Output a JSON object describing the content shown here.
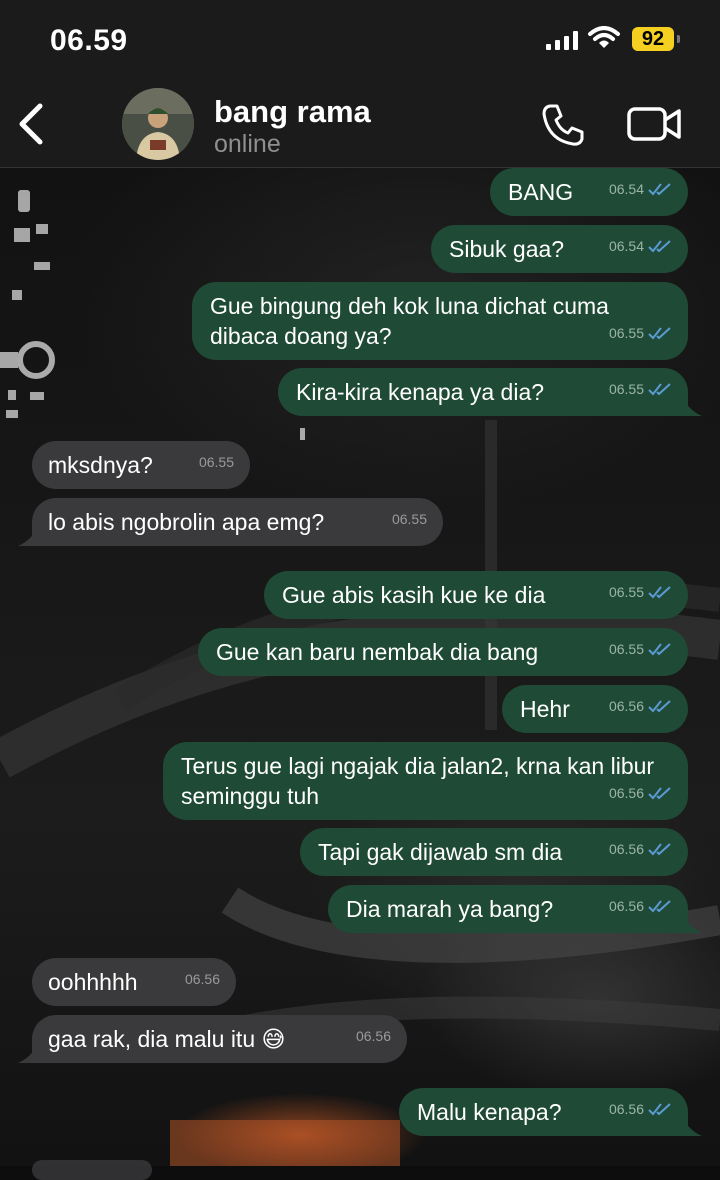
{
  "status_bar": {
    "time": "06.59",
    "battery": "92"
  },
  "header": {
    "name": "bang rama",
    "status": "online"
  },
  "messages": [
    {
      "dir": "out",
      "text": "BANG",
      "time": "06.54"
    },
    {
      "dir": "out",
      "text": "Sibuk gaa?",
      "time": "06.54"
    },
    {
      "dir": "out",
      "text": "Gue bingung deh kok luna dichat cuma dibaca doang ya?",
      "time": "06.55"
    },
    {
      "dir": "out",
      "text": "Kira-kira kenapa ya dia?",
      "time": "06.55"
    },
    {
      "dir": "in",
      "text": "mksdnya?",
      "time": "06.55"
    },
    {
      "dir": "in",
      "text": "lo abis ngobrolin apa emg?",
      "time": "06.55"
    },
    {
      "dir": "out",
      "text": "Gue abis kasih kue ke dia",
      "time": "06.55"
    },
    {
      "dir": "out",
      "text": "Gue kan baru nembak dia bang",
      "time": "06.55"
    },
    {
      "dir": "out",
      "text": "Hehr",
      "time": "06.56"
    },
    {
      "dir": "out",
      "text": "Terus gue lagi ngajak dia jalan2, krna kan libur seminggu tuh",
      "time": "06.56"
    },
    {
      "dir": "out",
      "text": "Tapi gak dijawab sm dia",
      "time": "06.56"
    },
    {
      "dir": "out",
      "text": "Dia marah ya bang?",
      "time": "06.56"
    },
    {
      "dir": "in",
      "text": "oohhhhh",
      "time": "06.56"
    },
    {
      "dir": "in",
      "text": "gaa rak, dia malu itu 😅",
      "time": "06.56"
    },
    {
      "dir": "out",
      "text": "Malu kenapa?",
      "time": "06.56"
    }
  ],
  "colors": {
    "outgoing": "#1f4a36",
    "incoming": "#3a3a3c",
    "read_ticks": "#5b9bd5"
  }
}
